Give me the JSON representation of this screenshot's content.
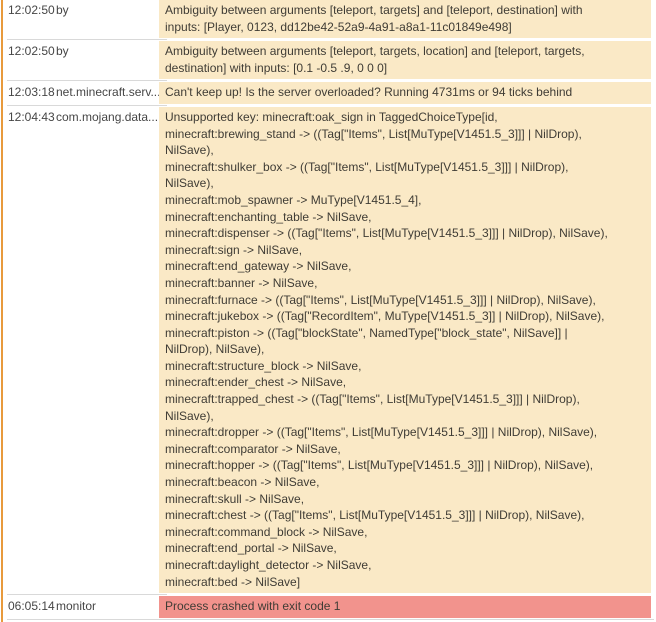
{
  "colors": {
    "accent_border": "#e89a3c",
    "warning_bg": "#fae9c6",
    "error_bg": "#f2938d",
    "separator": "#d9d9d9",
    "text": "#3f3c35",
    "meta_text": "#464646"
  },
  "log": {
    "rows": [
      {
        "time": "12:02:50",
        "source": "by",
        "level": "warn",
        "message": "Ambiguity between arguments [teleport, targets] and [teleport, destination] with\ninputs: [Player, 0123, dd12be42-52a9-4a91-a8a1-11c01849e498]"
      },
      {
        "time": "12:02:50",
        "source": "by",
        "level": "warn",
        "message": "Ambiguity between arguments [teleport, targets, location] and [teleport, targets,\ndestination] with inputs: [0.1 -0.5 .9, 0 0 0]"
      },
      {
        "time": "12:03:18",
        "source": "net.minecraft.serv...",
        "level": "warn",
        "message": "Can't keep up! Is the server overloaded? Running 4731ms or 94 ticks behind"
      },
      {
        "time": "12:04:43",
        "source": "com.mojang.data...",
        "level": "warn",
        "message": "Unsupported key: minecraft:oak_sign in TaggedChoiceType[id,\nminecraft:brewing_stand -> ((Tag[\"Items\", List[MuType[V1451.5_3]]] | NilDrop),\nNilSave),\nminecraft:shulker_box -> ((Tag[\"Items\", List[MuType[V1451.5_3]]] | NilDrop),\nNilSave),\nminecraft:mob_spawner -> MuType[V1451.5_4],\nminecraft:enchanting_table -> NilSave,\nminecraft:dispenser -> ((Tag[\"Items\", List[MuType[V1451.5_3]]] | NilDrop), NilSave),\nminecraft:sign -> NilSave,\nminecraft:end_gateway -> NilSave,\nminecraft:banner -> NilSave,\nminecraft:furnace -> ((Tag[\"Items\", List[MuType[V1451.5_3]]] | NilDrop), NilSave),\nminecraft:jukebox -> ((Tag[\"RecordItem\", MuType[V1451.5_3]] | NilDrop), NilSave),\nminecraft:piston -> ((Tag[\"blockState\", NamedType[\"block_state\", NilSave]] |\nNilDrop), NilSave),\nminecraft:structure_block -> NilSave,\nminecraft:ender_chest -> NilSave,\nminecraft:trapped_chest -> ((Tag[\"Items\", List[MuType[V1451.5_3]]] | NilDrop),\nNilSave),\nminecraft:dropper -> ((Tag[\"Items\", List[MuType[V1451.5_3]]] | NilDrop), NilSave),\nminecraft:comparator -> NilSave,\nminecraft:hopper -> ((Tag[\"Items\", List[MuType[V1451.5_3]]] | NilDrop), NilSave),\nminecraft:beacon -> NilSave,\nminecraft:skull -> NilSave,\nminecraft:chest -> ((Tag[\"Items\", List[MuType[V1451.5_3]]] | NilDrop), NilSave),\nminecraft:command_block -> NilSave,\nminecraft:end_portal -> NilSave,\nminecraft:daylight_detector -> NilSave,\nminecraft:bed -> NilSave]"
      },
      {
        "time": "06:05:14",
        "source": "monitor",
        "level": "error",
        "message": "Process crashed with exit code 1"
      }
    ]
  }
}
